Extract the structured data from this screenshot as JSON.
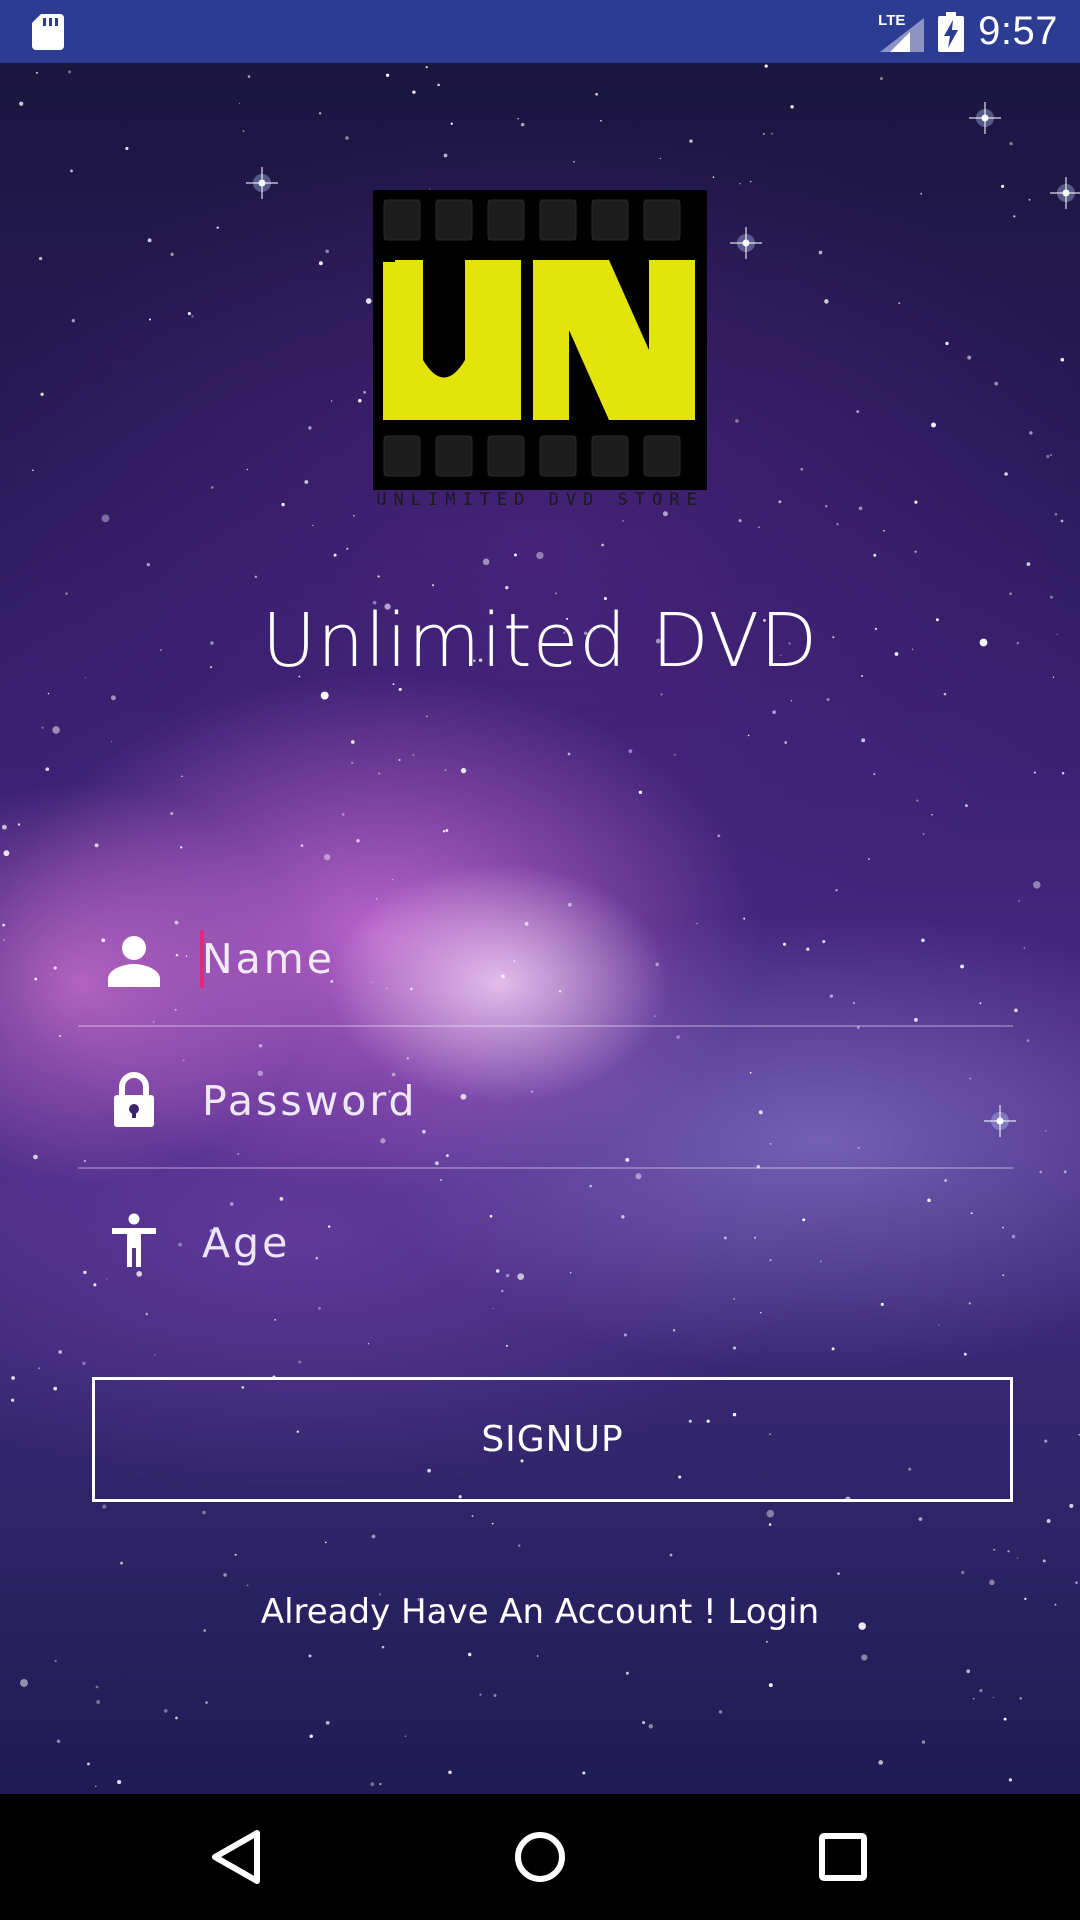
{
  "status_bar": {
    "network_label": "LTE",
    "time": "9:57",
    "icons": [
      "sd-card-icon",
      "lte-signal-icon",
      "battery-charging-icon"
    ],
    "background_color": "#2c3c93"
  },
  "logo": {
    "letters": "UN",
    "tagline": "UNLIMITED DVD STORE",
    "accent_color": "#e3e40a"
  },
  "app_title": "Unlimited DVD",
  "form": {
    "name": {
      "placeholder": "Name",
      "value": "",
      "icon": "person-icon"
    },
    "password": {
      "placeholder": "Password",
      "value": "",
      "icon": "lock-icon"
    },
    "age": {
      "placeholder": "Age",
      "value": "",
      "icon": "accessibility-icon"
    },
    "caret_color": "#e2287a"
  },
  "signup_label": "SIGNUP",
  "login_text": "Already Have An Account ! Login",
  "nav_bar": {
    "buttons": [
      "back-icon",
      "home-icon",
      "recents-icon"
    ]
  }
}
